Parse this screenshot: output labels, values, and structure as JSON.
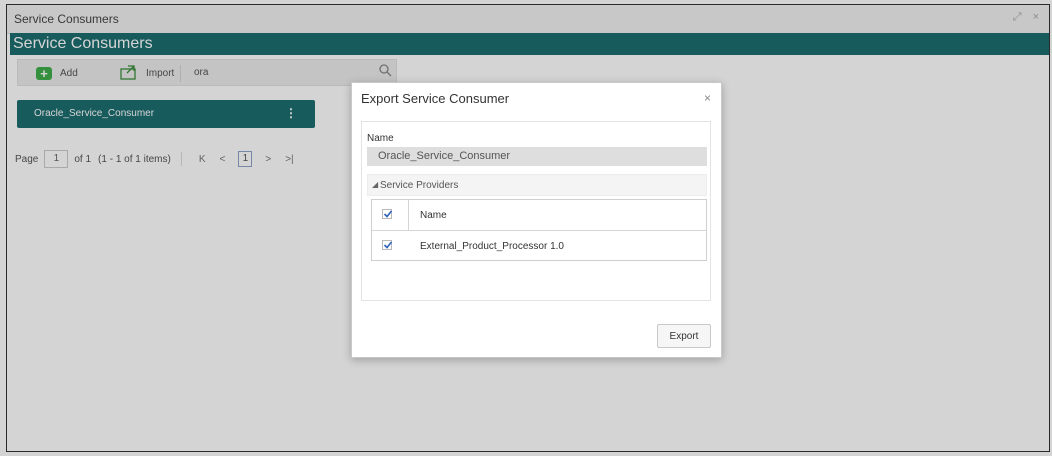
{
  "window": {
    "title": "Service Consumers",
    "controls": "⤢ ×"
  },
  "header": {
    "title": "Service Consumers"
  },
  "toolbar": {
    "add_label": "Add",
    "import_label": "Import",
    "search_value": "ora"
  },
  "consumers": [
    {
      "label": "Oracle_Service_Consumer"
    }
  ],
  "pagination": {
    "page_label": "Page",
    "page_value": "1",
    "of_label": "of 1",
    "items_label": "(1 - 1 of 1 items)",
    "first": "K",
    "prev": "<",
    "current": "1",
    "next": ">",
    "last": ">|"
  },
  "dialog": {
    "title": "Export Service Consumer",
    "close": "×",
    "name_label": "Name",
    "name_value": "Oracle_Service_Consumer",
    "section_title": "Service Providers",
    "table": {
      "header": "Name",
      "header_checked": true,
      "rows": [
        {
          "name": "External_Product_Processor 1.0",
          "checked": true
        }
      ]
    },
    "export_label": "Export"
  },
  "colors": {
    "header_teal": "#1d6e70",
    "add_green": "#3fae49",
    "check_blue": "#2e63b8"
  }
}
